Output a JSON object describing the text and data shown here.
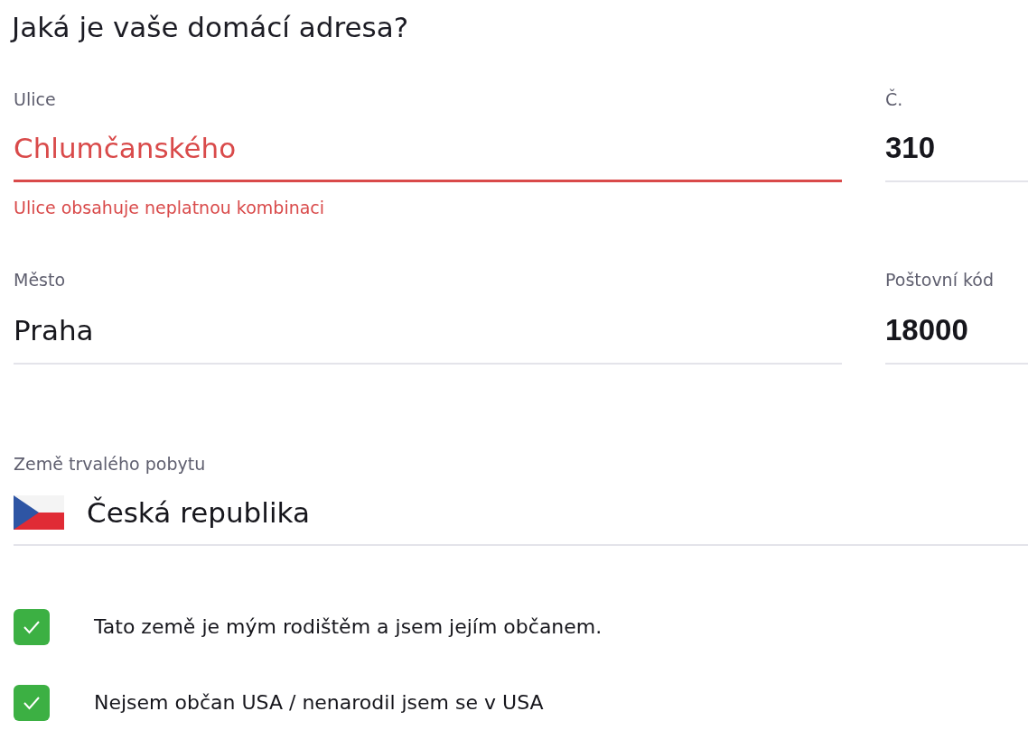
{
  "title": "Jaká je vaše domácí adresa?",
  "rows": [
    {
      "fields": [
        {
          "kind": "text",
          "label": "Ulice",
          "value": "Chlumčanského",
          "invalid": true,
          "error": "Ulice obsahuje neplatnou kombinaci"
        },
        {
          "kind": "number",
          "label": "Č.",
          "value": "310",
          "invalid": false
        }
      ]
    },
    {
      "fields": [
        {
          "kind": "text",
          "label": "Město",
          "value": "Praha",
          "invalid": false
        },
        {
          "kind": "number",
          "label": "Poštovní kód",
          "value": "18000",
          "invalid": false
        }
      ]
    }
  ],
  "country": {
    "label": "Země trvalého pobytu",
    "value": "Česká republika"
  },
  "checkboxes": [
    {
      "label": "Tato země je mým rodištěm a jsem jejím občanem.",
      "checked": true
    },
    {
      "label": "Nejsem občan USA / nenarodil jsem se v USA",
      "checked": true
    }
  ]
}
